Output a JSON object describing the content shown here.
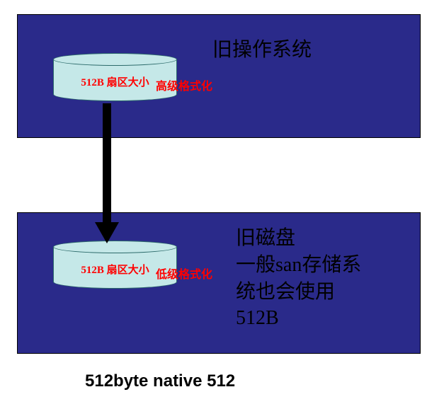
{
  "topBox": {
    "title": "旧操作系统",
    "cylinderLabel": "512B 扇区大小",
    "formatLabel": "高级格式化"
  },
  "bottomBox": {
    "titleLine1": "旧磁盘",
    "titleLine2": "一般san存储系",
    "titleLine3": "统也会使用",
    "titleLine4": "512B",
    "cylinderLabel": "512B 扇区大小",
    "formatLabel": "低级格式化"
  },
  "caption": "512byte native 512"
}
